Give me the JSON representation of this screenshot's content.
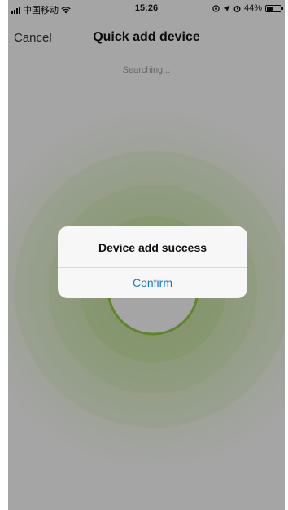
{
  "status_bar": {
    "carrier": "中国移动",
    "time": "15:26",
    "battery_text": "44%",
    "battery_level": 0.44
  },
  "navbar": {
    "cancel_label": "Cancel",
    "title": "Quick add device"
  },
  "status": {
    "searching_text": "Searching..."
  },
  "alert": {
    "title": "Device add success",
    "confirm_label": "Confirm"
  },
  "colors": {
    "accent_green": "#8cc63f",
    "link_blue": "#1b77d1"
  }
}
